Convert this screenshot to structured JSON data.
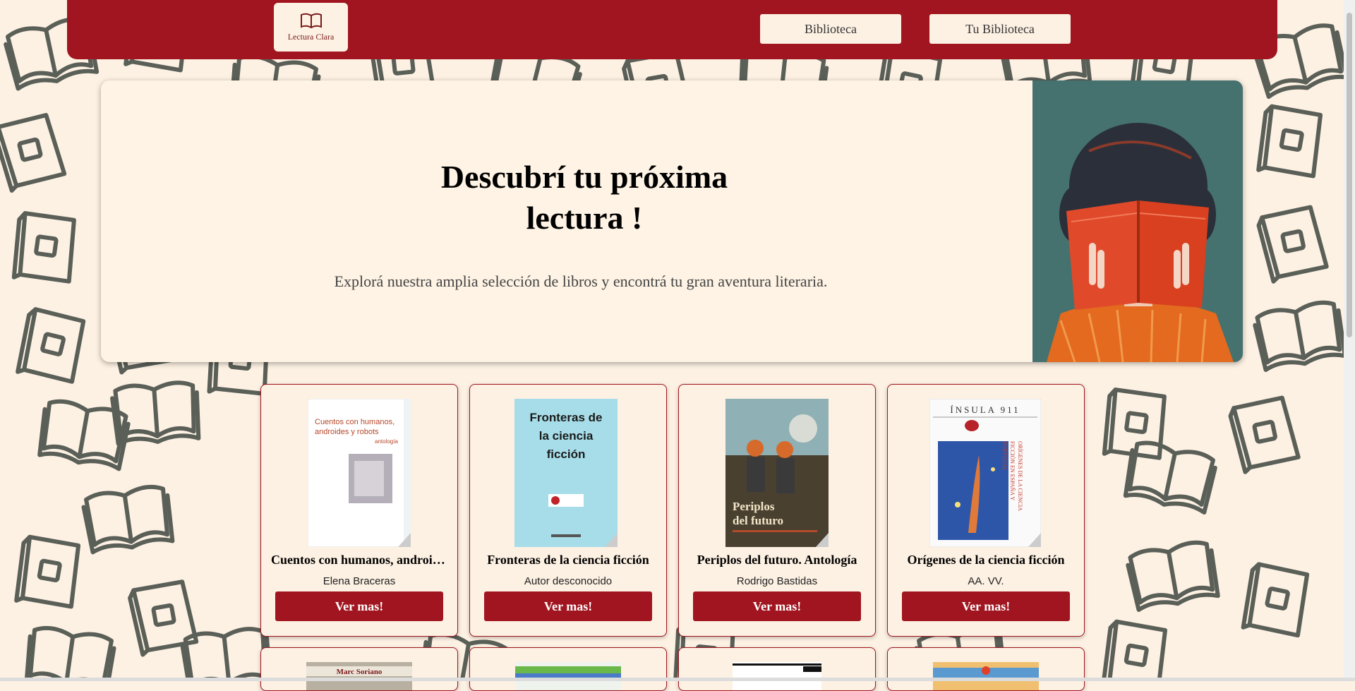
{
  "nav": {
    "logo_text": "Lectura Clara",
    "links": [
      {
        "label": "Biblioteca"
      },
      {
        "label": "Tu Biblioteca"
      }
    ]
  },
  "hero": {
    "title_line1": "Descubrí tu próxima",
    "title_line2": "lectura !",
    "subtitle": "Explorá nuestra amplia selección de libros y encontrá tu gran aventura literaria."
  },
  "books": [
    {
      "title": "Cuentos con humanos, androides y robots",
      "author": "Elena Braceras",
      "button": "Ver mas!",
      "cover_text": [
        "Cuentos con humanos,",
        "androides y robots",
        "antología"
      ]
    },
    {
      "title": "Fronteras de la ciencia ficción",
      "author": "Autor desconocido",
      "button": "Ver mas!",
      "cover_text": [
        "Fronteras de",
        "la ciencia",
        "ficción"
      ]
    },
    {
      "title": "Periplos del futuro. Antología",
      "author": "Rodrigo Bastidas",
      "button": "Ver mas!",
      "cover_text": [
        "Periplos",
        "del futuro"
      ]
    },
    {
      "title": "Orígenes de la ciencia ficción",
      "author": "AA. VV.",
      "button": "Ver mas!",
      "cover_text": [
        "ÍNSULA 911",
        "ORÍGENES DE LA CIENCIA",
        "FICCIÓN EN ESPAÑA Y",
        "PORTUGAL"
      ]
    }
  ],
  "partial_row": {
    "first_cover_text": "Marc Soriano"
  },
  "colors": {
    "brand_red": "#a0151f",
    "cream": "#fdf1e3",
    "pattern": "#5a5f58"
  }
}
